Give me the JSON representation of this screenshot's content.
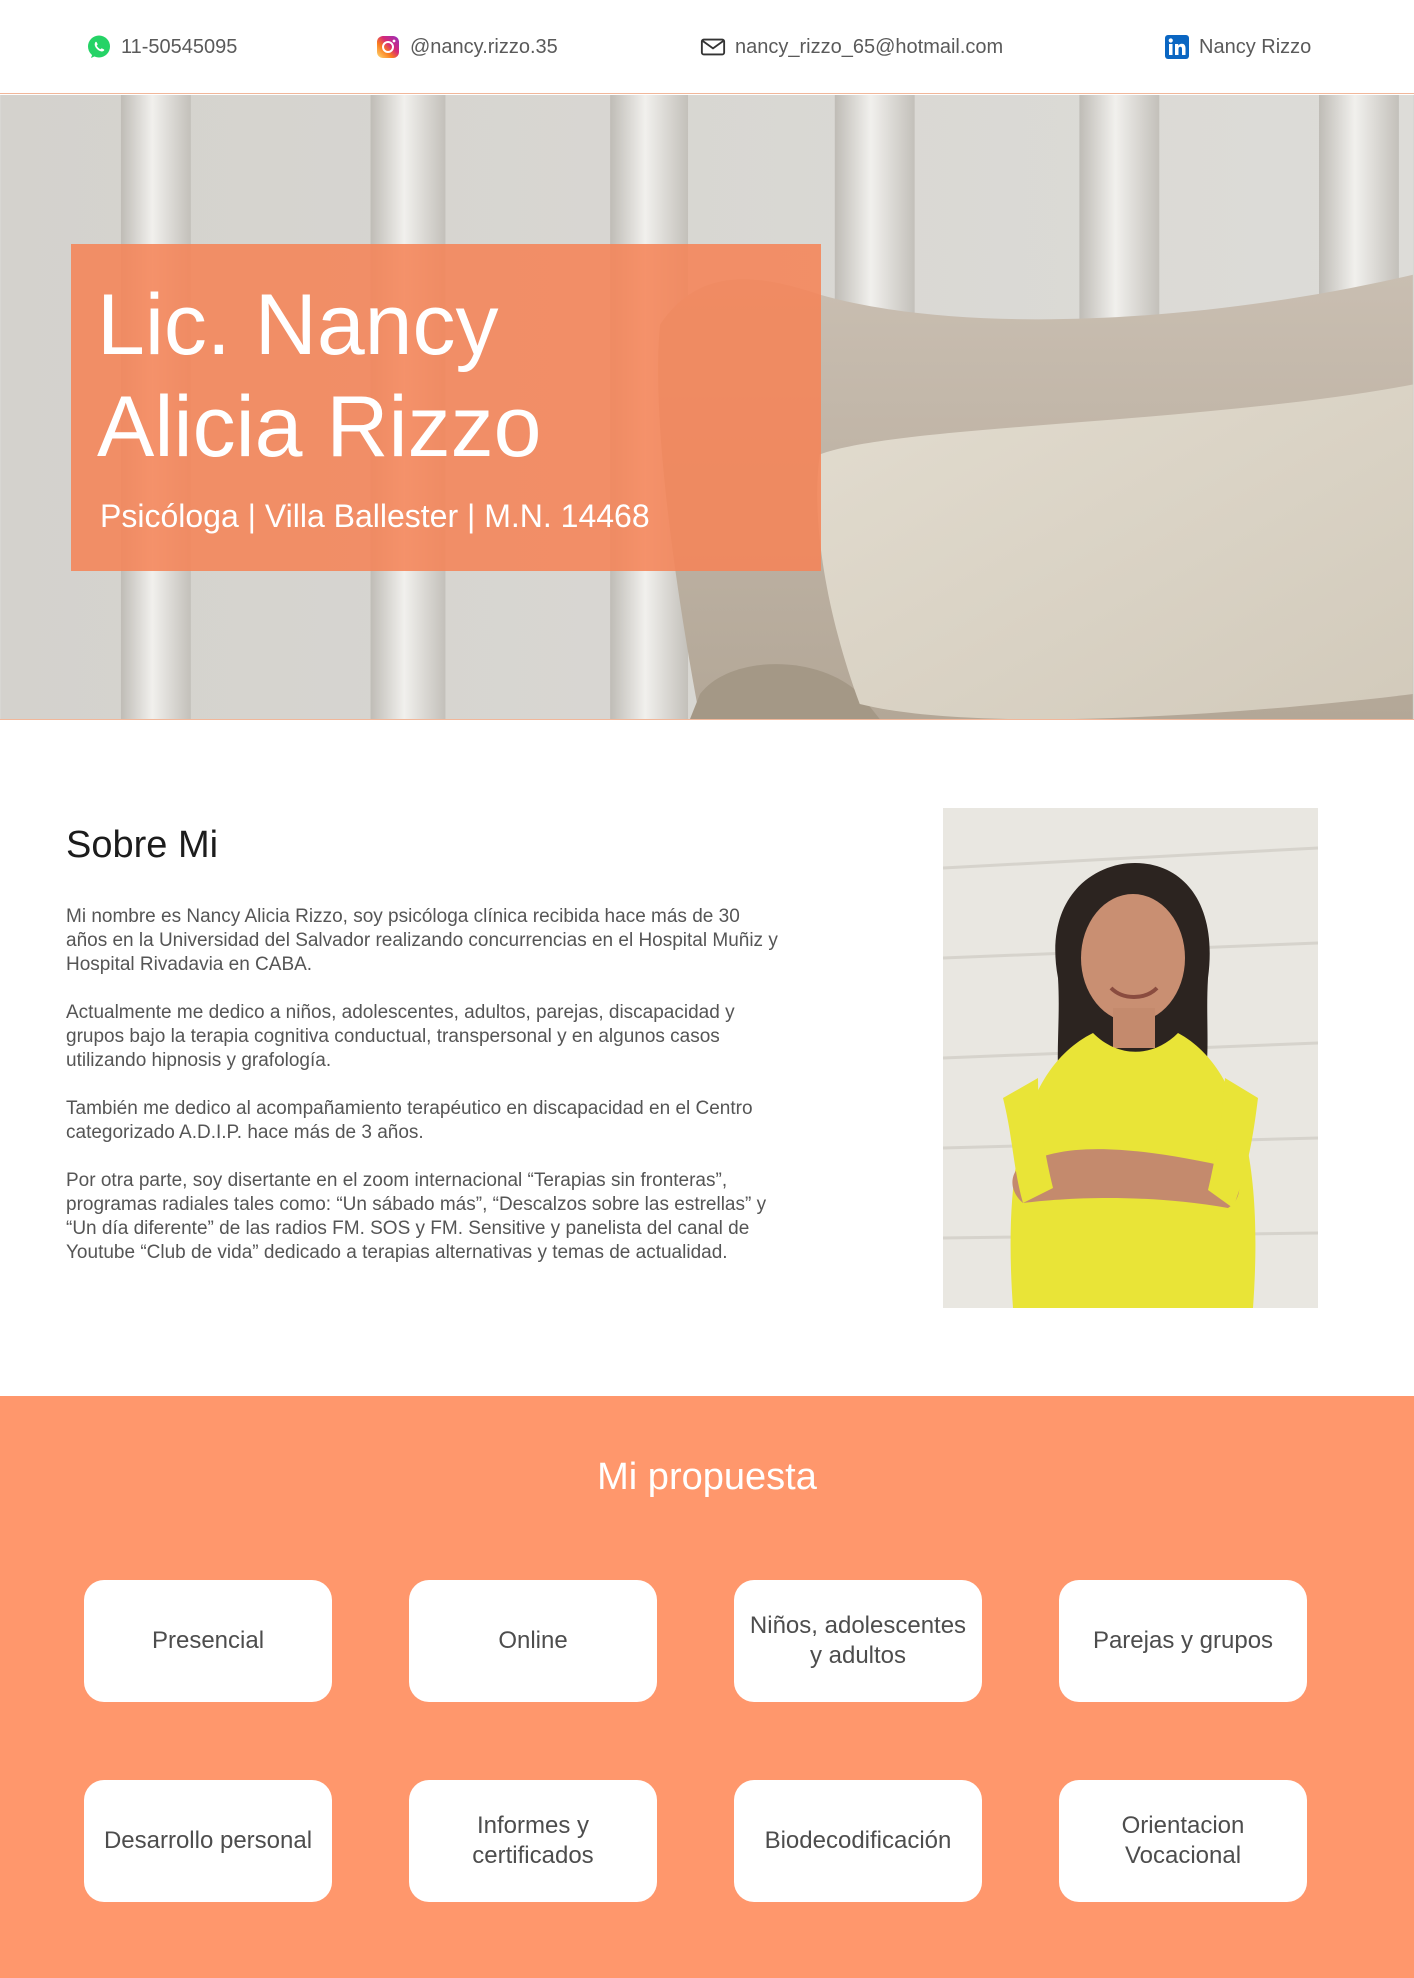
{
  "contacts": {
    "phone": {
      "icon": "whatsapp-icon",
      "text": "11-50545095"
    },
    "instagram": {
      "icon": "instagram-icon",
      "text": "@nancy.rizzo.35"
    },
    "email": {
      "icon": "mail-icon",
      "text": "nancy_rizzo_65@hotmail.com"
    },
    "linkedin": {
      "icon": "linkedin-icon",
      "text": "Nancy Rizzo"
    }
  },
  "hero": {
    "title": "Lic. Nancy Alicia Rizzo",
    "subtitle": "Psicóloga | Villa Ballester | M.N. 14468"
  },
  "about": {
    "title": "Sobre Mi",
    "paragraphs": [
      "Mi nombre es Nancy Alicia Rizzo, soy psicóloga clínica recibida hace más de 30 años en la Universidad del Salvador realizando concurrencias en el Hospital Muñiz y Hospital Rivadavia en CABA.",
      "Actualmente me dedico a niños, adolescentes, adultos, parejas, discapacidad y grupos bajo la terapia cognitiva conductual, transpersonal y en algunos casos utilizando hipnosis y grafología.",
      "También me dedico al acompañamiento terapéutico en discapacidad en el Centro categorizado A.D.I.P. hace más de 3 años.",
      "Por otra parte, soy disertante en el zoom internacional “Terapias sin fronteras”, programas radiales tales como: “Un sábado más”, “Descalzos sobre las estrellas” y “Un día diferente” de las radios FM. SOS y FM. Sensitive y panelista del canal de Youtube “Club de vida” dedicado a terapias alternativas y temas de actualidad."
    ]
  },
  "proposal": {
    "title": "Mi propuesta",
    "cards": [
      "Presencial",
      "Online",
      "Niños, adolescentes y adultos",
      "Parejas y grupos",
      "Desarrollo personal",
      "Informes y certificados",
      "Biodecodificación",
      "Orientacion Vocacional"
    ]
  },
  "colors": {
    "accent": "#ff976c",
    "hero_box": "#f58458",
    "whatsapp": "#25d366",
    "linkedin": "#0a66c2"
  }
}
